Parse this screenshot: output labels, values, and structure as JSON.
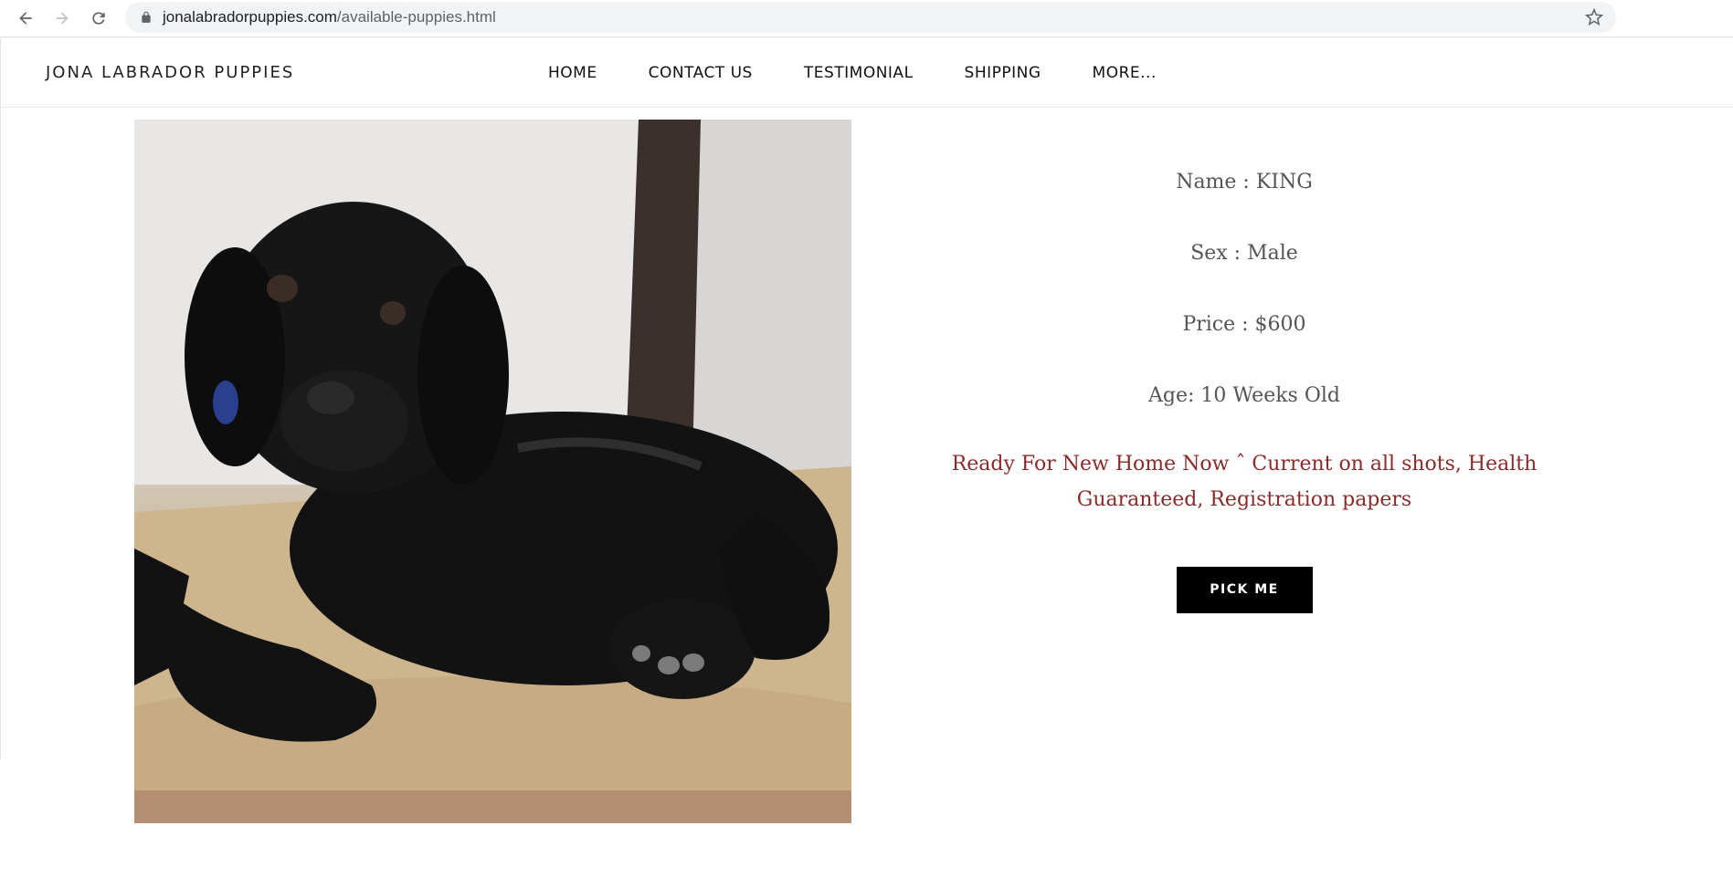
{
  "browser": {
    "url_domain": "jonalabradorpuppies.com",
    "url_path": "/available-puppies.html"
  },
  "site": {
    "brand": "JONA LABRADOR PUPPIES",
    "nav": [
      {
        "label": "HOME"
      },
      {
        "label": "CONTACT US"
      },
      {
        "label": "TESTIMONIAL"
      },
      {
        "label": "SHIPPING"
      },
      {
        "label": "MORE..."
      }
    ]
  },
  "puppy": {
    "name_line": "Name : KING",
    "sex_line": "Sex : Male",
    "price_line": "Price : $600",
    "age_line": "Age: 10 Weeks Old",
    "note": "Ready For New Home Now ˆ Current on all shots, Health Guaranteed, Registration papers",
    "button_label": "PICK ME"
  },
  "colors": {
    "note_text": "#8b2a2a",
    "button_bg": "#000000"
  }
}
